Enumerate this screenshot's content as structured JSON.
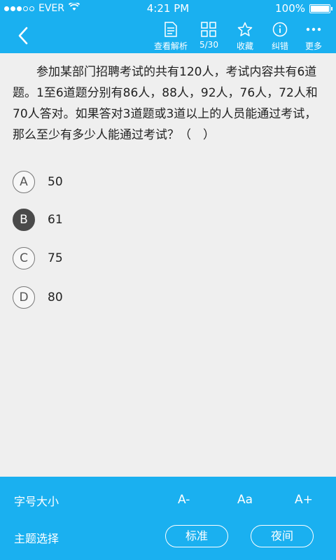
{
  "status_bar": {
    "carrier": "EVER",
    "time": "4:21 PM",
    "battery": "100%"
  },
  "toolbar": {
    "items": [
      {
        "label": "查看解析",
        "icon": "document-icon"
      },
      {
        "label": "5/30",
        "icon": "grid-icon"
      },
      {
        "label": "收藏",
        "icon": "star-icon"
      },
      {
        "label": "纠错",
        "icon": "info-icon"
      },
      {
        "label": "更多",
        "icon": "more-icon"
      }
    ]
  },
  "question": {
    "text": "参加某部门招聘考试的共有120人，考试内容共有6道题。1至6道题分别有86人，88人，92人，76人，72人和70人答对。如果答对3道题或3道以上的人员能通过考试，那么至少有多少人能通过考试？（　）"
  },
  "options": [
    {
      "letter": "A",
      "value": "50",
      "selected": false
    },
    {
      "letter": "B",
      "value": "61",
      "selected": true
    },
    {
      "letter": "C",
      "value": "75",
      "selected": false
    },
    {
      "letter": "D",
      "value": "80",
      "selected": false
    }
  ],
  "settings": {
    "font_size_label": "字号大小",
    "font_small": "A-",
    "font_medium": "Aa",
    "font_large": "A+",
    "theme_label": "主题选择",
    "theme_standard": "标准",
    "theme_night": "夜间"
  },
  "colors": {
    "accent": "#1ab0f0",
    "background": "#efefef",
    "selected_option": "#4a4a4a"
  }
}
